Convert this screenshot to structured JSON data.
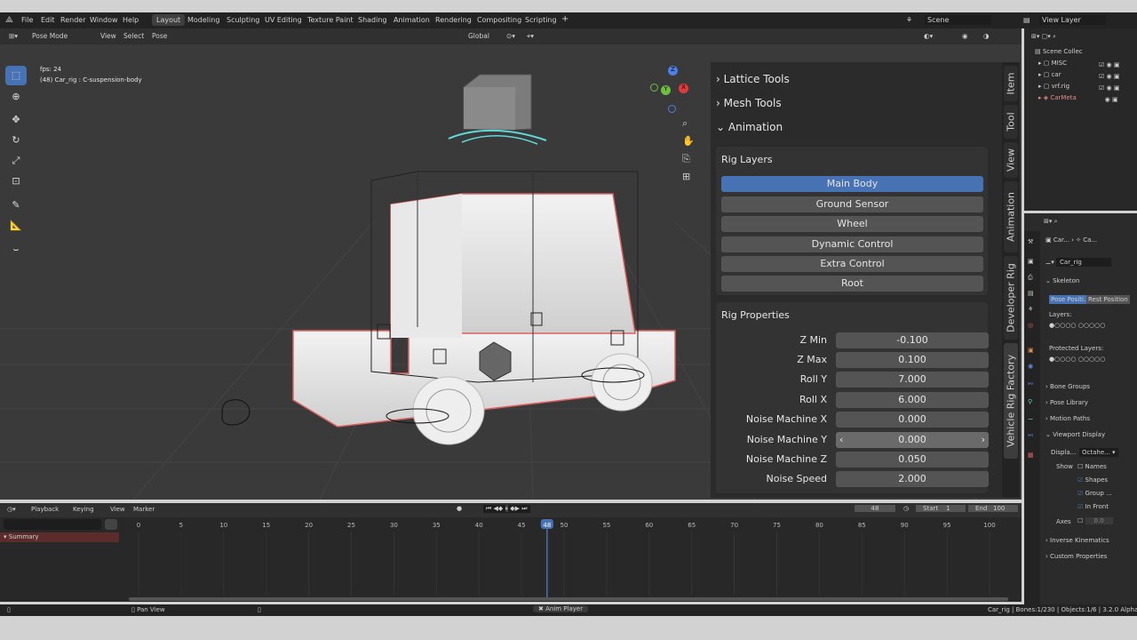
{
  "menu": {
    "items": [
      "File",
      "Edit",
      "Render",
      "Window",
      "Help"
    ],
    "workspaces": [
      "Layout",
      "Modeling",
      "Sculpting",
      "UV Editing",
      "Texture Paint",
      "Shading",
      "Animation",
      "Rendering",
      "Compositing",
      "Scripting"
    ],
    "active_workspace": "Layout",
    "add_tab": "+",
    "scene_label": "Scene",
    "view_layer_label": "View Layer"
  },
  "viewport_header": {
    "mode": "Pose Mode",
    "menus": [
      "View",
      "Select",
      "Pose"
    ],
    "orientation": "Global",
    "pose_options": "Pose Options",
    "x_label": "X"
  },
  "overlay": {
    "fps": "fps: 24",
    "object_info": "(48) Car_rig : C-suspension-body"
  },
  "gizmo": {
    "x": "X",
    "y": "Y",
    "z": "Z"
  },
  "npanel": {
    "collapsed": [
      "Lattice Tools",
      "Mesh Tools"
    ],
    "expanded": "Animation",
    "rig_layers_title": "Rig Layers",
    "rig_layers": [
      "Main Body",
      "Ground Sensor",
      "Wheel",
      "Dynamic Control",
      "Extra Control",
      "Root"
    ],
    "selected_layer": "Main Body",
    "rig_properties_title": "Rig Properties",
    "properties": [
      {
        "label": "Z Min",
        "value": "-0.100"
      },
      {
        "label": "Z Max",
        "value": "0.100"
      },
      {
        "label": "Roll Y",
        "value": "7.000"
      },
      {
        "label": "Roll X",
        "value": "6.000"
      },
      {
        "label": "Noise Machine X",
        "value": "0.000"
      },
      {
        "label": "Noise Machine Y",
        "value": "0.000"
      },
      {
        "label": "Noise Machine Z",
        "value": "0.050"
      },
      {
        "label": "Noise Speed",
        "value": "2.000"
      }
    ],
    "vertical_tabs": [
      "Item",
      "Tool",
      "View",
      "Animation",
      "Developer Rig",
      "Vehicle Rig Factory"
    ]
  },
  "outliner": {
    "title": "Scene Collec",
    "items": [
      "MISC",
      "car",
      "vrf.rig",
      "CarMeta"
    ]
  },
  "properties_panel": {
    "breadcrumb": [
      "Car...",
      "Ca..."
    ],
    "object_name": "Car_rig",
    "skeleton": "Skeleton",
    "pose_position": "Pose Positi...",
    "rest_position": "Rest Position",
    "layers": "Layers:",
    "protected_layers": "Protected Layers:",
    "sections": [
      "Bone Groups",
      "Pose Library",
      "Motion Paths"
    ],
    "viewport_display": "Viewport Display",
    "display_label": "Displa...",
    "display_value": "Octahe...",
    "show_label": "Show",
    "show_items": [
      "Names",
      "Shapes",
      "Group ...",
      "In Front"
    ],
    "axes_label": "Axes",
    "axes_value": "0.0",
    "more_sections": [
      "Inverse Kinematics",
      "Custom Properties"
    ]
  },
  "timeline": {
    "menus": [
      "Playback",
      "Keying",
      "View",
      "Marker"
    ],
    "current_frame": "48",
    "start_label": "Start",
    "start_value": "1",
    "end_label": "End",
    "end_value": "100",
    "ticks": [
      "0",
      "5",
      "10",
      "15",
      "20",
      "25",
      "30",
      "35",
      "40",
      "45",
      "50",
      "55",
      "60",
      "65",
      "70",
      "75",
      "80",
      "85",
      "90",
      "95",
      "100"
    ],
    "playhead_frame": 48,
    "summary": "Summary"
  },
  "status": {
    "pan_view": "Pan View",
    "anim_player": "Anim Player",
    "info": "Car_rig | Bones:1/230 | Objects:1/6 | 3.2.0 Alpha"
  },
  "colors": {
    "accent": "#4772b3",
    "selected_outline": "#e06060"
  }
}
